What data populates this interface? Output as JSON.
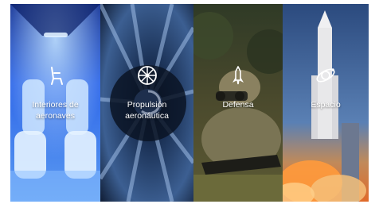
{
  "panels": [
    {
      "label": "Interiores de aeronaves",
      "icon": "aircraft-seat-icon"
    },
    {
      "label": "Propulsión aeronáutica",
      "icon": "turbine-fan-icon"
    },
    {
      "label": "Defensa",
      "icon": "missile-icon"
    },
    {
      "label": "Espacio",
      "icon": "satellite-orbit-icon"
    }
  ],
  "colors": {
    "label_text": "#ffffff",
    "interiors_blue": "#1f4fd6",
    "propulsion_navy": "#10213d",
    "defense_olive": "#4b4a2d",
    "space_sky": "#3a5f95"
  }
}
